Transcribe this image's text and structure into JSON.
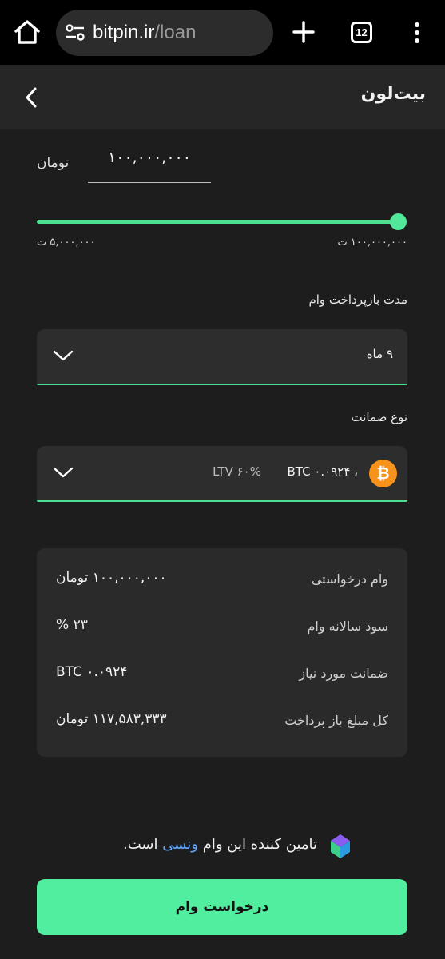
{
  "browser": {
    "url_host": "bitpin.ir",
    "url_path": "/loan",
    "tab_count": "12"
  },
  "header": {
    "title": "بیت‌لون"
  },
  "amount": {
    "value": "۱۰۰,۰۰۰,۰۰۰",
    "unit": "تومان",
    "slider_fraction": 1.0,
    "slider_max_label": "۱۰۰,۰۰۰,۰۰۰ ت",
    "slider_min_label": "۵,۰۰۰,۰۰۰ ت"
  },
  "repayment": {
    "label": "مدت بازپرداخت وام",
    "selected": "۹ ماه"
  },
  "collateral": {
    "label": "نوع ضمانت",
    "text": "BTC ۰.۰۹۲۴ ،",
    "ltv": "LTV ۶۰%"
  },
  "summary": {
    "rows": [
      {
        "label": "وام درخواستی",
        "value": "۱۰۰,۰۰۰,۰۰۰ تومان"
      },
      {
        "label": "سود سالانه وام",
        "value": "۲۳ %"
      },
      {
        "label": "ضمانت مورد نیاز",
        "value": "۰.۰۹۲۴ BTC"
      },
      {
        "label": "کل مبلغ باز پرداخت",
        "value": "۱۱۷,۵۸۳,۳۳۳ تومان"
      }
    ]
  },
  "provider": {
    "text_before": "تامین کننده این وام ",
    "link": "ونسی",
    "text_after": " است."
  },
  "request_button": {
    "label": "درخواست وام"
  },
  "colors": {
    "accent": "#4be08f",
    "button": "#52eea0",
    "link": "#5fa8ff",
    "bitcoin": "#f7931a"
  }
}
